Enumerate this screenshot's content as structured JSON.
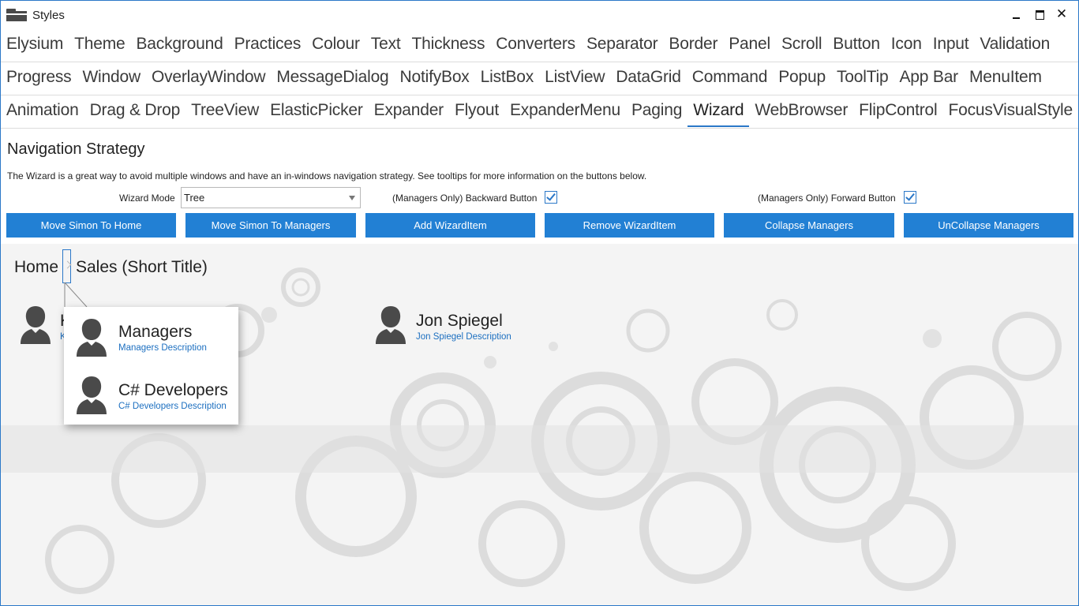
{
  "window": {
    "title": "Styles"
  },
  "window_controls": {
    "minimize": "",
    "maximize": "",
    "close": "✕"
  },
  "tabs": {
    "row1": [
      "Elysium",
      "Theme",
      "Background",
      "Practices",
      "Colour",
      "Text",
      "Thickness",
      "Converters",
      "Separator",
      "Border",
      "Panel",
      "Scroll",
      "Button",
      "Icon",
      "Input",
      "Validation"
    ],
    "row2": [
      "Progress",
      "Window",
      "OverlayWindow",
      "MessageDialog",
      "NotifyBox",
      "ListBox",
      "ListView",
      "DataGrid",
      "Command",
      "Popup",
      "ToolTip",
      "App Bar",
      "MenuItem"
    ],
    "row3": [
      "Animation",
      "Drag & Drop",
      "TreeView",
      "ElasticPicker",
      "Expander",
      "Flyout",
      "ExpanderMenu",
      "Paging",
      "Wizard",
      "WebBrowser",
      "FlipControl",
      "FocusVisualStyle"
    ],
    "selected": "Wizard"
  },
  "content": {
    "title": "Navigation Strategy",
    "description": "The Wizard is a great way to avoid multiple windows and have an in-windows navigation strategy. See tooltips for more information on the buttons below.",
    "wizard_mode_label": "Wizard Mode",
    "wizard_mode_value": "Tree",
    "backward_label": "(Managers Only) Backward Button",
    "backward_checked": true,
    "forward_label": "(Managers Only) Forward Button",
    "forward_checked": true
  },
  "buttons": [
    "Move Simon To Home",
    "Move Simon To Managers",
    "Add WizardItem",
    "Remove WizardItem",
    "Collapse Managers",
    "UnCollapse Managers"
  ],
  "breadcrumb": {
    "home": "Home",
    "current": "Sales (Short Title)"
  },
  "people": [
    {
      "name": "K",
      "desc": "K"
    },
    {
      "name": "Jon Spiegel",
      "desc": "Jon Spiegel Description"
    }
  ],
  "popup_items": [
    {
      "name": "Managers",
      "desc": "Managers Description"
    },
    {
      "name": "C# Developers",
      "desc": "C# Developers Description"
    }
  ],
  "colors": {
    "accent": "#2280d4",
    "link": "#1c6fc0",
    "border": "#2b78c8",
    "icon": "#4a4a4a"
  },
  "icons": [
    "folder-icon",
    "minimize-icon",
    "maximize-icon",
    "close-icon",
    "chevron-down-icon",
    "checkbox-icon",
    "chevron-right-icon",
    "person-icon"
  ]
}
